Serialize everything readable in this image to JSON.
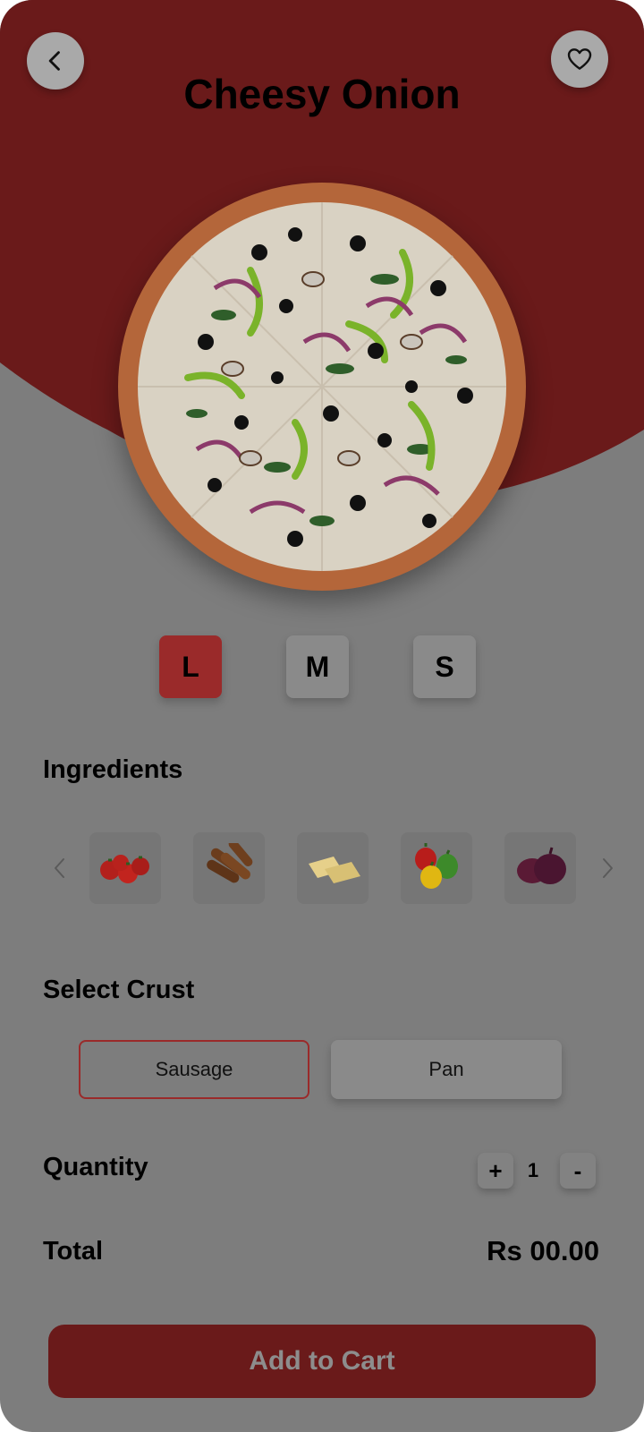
{
  "header": {
    "title": "Cheesy Onion",
    "back_icon": "chevron-left-icon",
    "favorite_icon": "heart-icon"
  },
  "sizes": [
    {
      "label": "L",
      "selected": true
    },
    {
      "label": "M",
      "selected": false
    },
    {
      "label": "S",
      "selected": false
    }
  ],
  "ingredients": {
    "title": "Ingredients",
    "items": [
      "tomato-icon",
      "sausage-icon",
      "cheese-icon",
      "bell-pepper-icon",
      "red-onion-icon"
    ]
  },
  "crust": {
    "title": "Select Crust",
    "options": [
      {
        "label": "Sausage",
        "selected": true
      },
      {
        "label": "Pan",
        "selected": false
      }
    ]
  },
  "quantity": {
    "label": "Quantity",
    "value": "1",
    "plus": "+",
    "minus": "-"
  },
  "total": {
    "label": "Total",
    "value": "Rs 00.00"
  },
  "cart": {
    "label": "Add to Cart"
  },
  "colors": {
    "accent": "#6a1a1a",
    "selected": "#9a2a2a",
    "background": "#7d7d7d"
  }
}
